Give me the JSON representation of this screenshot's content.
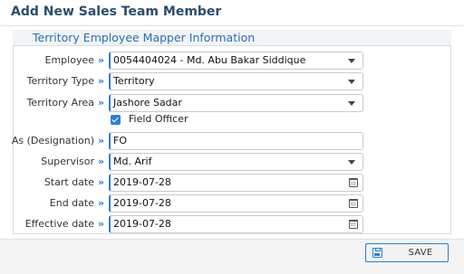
{
  "modal": {
    "title": "Add New Sales Team Member"
  },
  "section": {
    "title": "Territory Employee Mapper Information"
  },
  "arrow_glyph": "»",
  "fields": {
    "employee": {
      "label": "Employee",
      "value": "0054404024 - Md. Abu Bakar Siddique",
      "control": "select"
    },
    "territory_type": {
      "label": "Territory Type",
      "value": "Territory",
      "control": "select"
    },
    "territory_area": {
      "label": "Territory Area",
      "value": "Jashore Sadar",
      "control": "select"
    },
    "field_officer": {
      "label": "Field Officer",
      "checked": true
    },
    "designation": {
      "label": "As (Designation)",
      "value": "FO",
      "control": "text"
    },
    "supervisor": {
      "label": "Supervisor",
      "value": "Md. Arif",
      "control": "select"
    },
    "start_date": {
      "label": "Start date",
      "value": "2019-07-28",
      "control": "date",
      "icon": "calendar-icon"
    },
    "end_date": {
      "label": "End date",
      "value": "2019-07-28",
      "control": "date",
      "icon": "calendar-icon"
    },
    "effective_date": {
      "label": "Effective date",
      "value": "2019-07-28",
      "control": "date",
      "icon": "calendar-icon"
    }
  },
  "footer": {
    "save_label": "SAVE",
    "save_icon": "floppy-disk-icon"
  },
  "colors": {
    "accent": "#2a7fd4",
    "title": "#2a4d6e",
    "section_title": "#2a6fb4"
  }
}
